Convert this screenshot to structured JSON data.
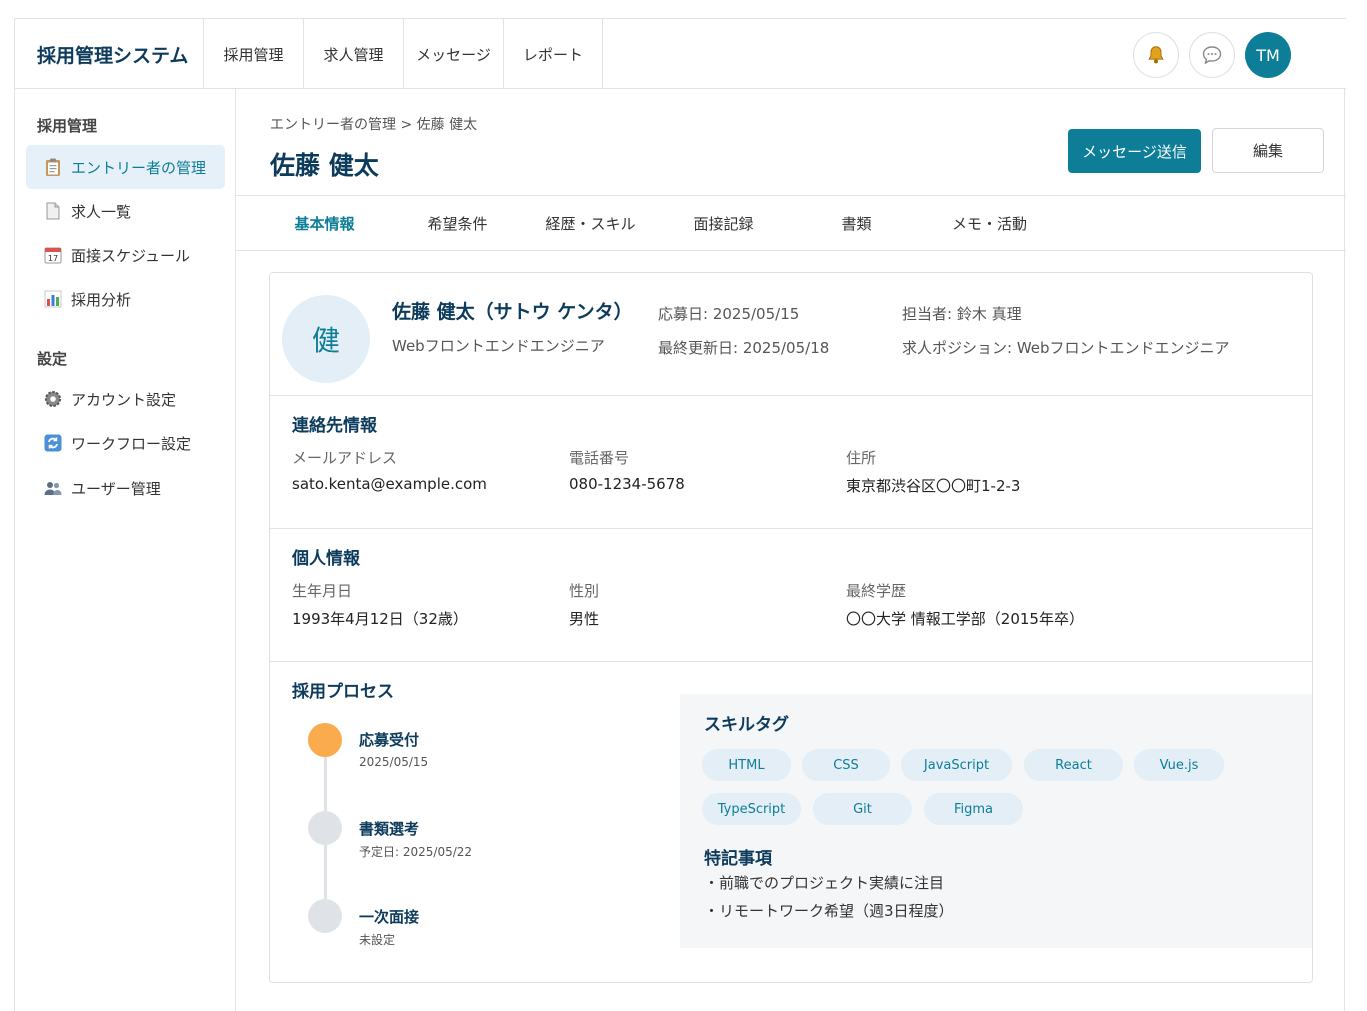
{
  "header": {
    "app_title": "採用管理システム",
    "nav": [
      "採用管理",
      "求人管理",
      "メッセージ",
      "レポート"
    ],
    "avatar_initials": "TM",
    "icons": [
      "bell-icon",
      "chat-icon"
    ]
  },
  "sidebar": {
    "section1": "採用管理",
    "items1": [
      {
        "label": "エントリー者の管理",
        "icon": "clipboard-icon"
      },
      {
        "label": "求人一覧",
        "icon": "document-icon"
      },
      {
        "label": "面接スケジュール",
        "icon": "calendar-icon"
      },
      {
        "label": "採用分析",
        "icon": "bar-chart-icon"
      }
    ],
    "section2": "設定",
    "items2": [
      {
        "label": "アカウント設定",
        "icon": "gear-icon"
      },
      {
        "label": "ワークフロー設定",
        "icon": "refresh-icon"
      },
      {
        "label": "ユーザー管理",
        "icon": "users-icon"
      }
    ]
  },
  "page": {
    "breadcrumb": "エントリー者の管理 > 佐藤 健太",
    "title": "佐藤 健太",
    "send_message_label": "メッセージ送信",
    "edit_label": "編集"
  },
  "tabs": [
    "基本情報",
    "希望条件",
    "経歴・スキル",
    "面接記録",
    "書類",
    "メモ・活動"
  ],
  "candidate": {
    "avatar_char": "健",
    "name": "佐藤 健太（サトウ ケンタ）",
    "role": "Webフロントエンドエンジニア",
    "applied": "応募日: 2025/05/15",
    "updated": "最終更新日: 2025/05/18",
    "owner": "担当者: 鈴木 真理",
    "position": "求人ポジション: Webフロントエンドエンジニア"
  },
  "contact": {
    "title": "連絡先情報",
    "email_label": "メールアドレス",
    "email": "sato.kenta@example.com",
    "phone_label": "電話番号",
    "phone": "080-1234-5678",
    "address_label": "住所",
    "address": "東京都渋谷区〇〇町1-2-3"
  },
  "personal": {
    "title": "個人情報",
    "birth_label": "生年月日",
    "birth": "1993年4月12日（32歳）",
    "gender_label": "性別",
    "gender": "男性",
    "edu_label": "最終学歴",
    "edu": "〇〇大学 情報工学部（2015年卒）"
  },
  "process": {
    "title": "採用プロセス",
    "steps": [
      {
        "title": "応募受付",
        "date": "2025/05/15",
        "status": "done"
      },
      {
        "title": "書類選考",
        "date": "予定日: 2025/05/22",
        "status": "pending"
      },
      {
        "title": "一次面接",
        "date": "未設定",
        "status": "pending"
      }
    ]
  },
  "skills": {
    "title": "スキルタグ",
    "tags": [
      "HTML",
      "CSS",
      "JavaScript",
      "React",
      "Vue.js",
      "TypeScript",
      "Git",
      "Figma"
    ]
  },
  "notes": {
    "title": "特記事項",
    "lines": [
      "・前職でのプロジェクト実績に注目",
      "・リモートワーク希望（週3日程度）"
    ]
  },
  "colors": {
    "accent": "#0e7d98",
    "heading": "#0d3b5c",
    "timeline_done": "#f9ab4e",
    "tag_bg": "#e3eef6"
  }
}
